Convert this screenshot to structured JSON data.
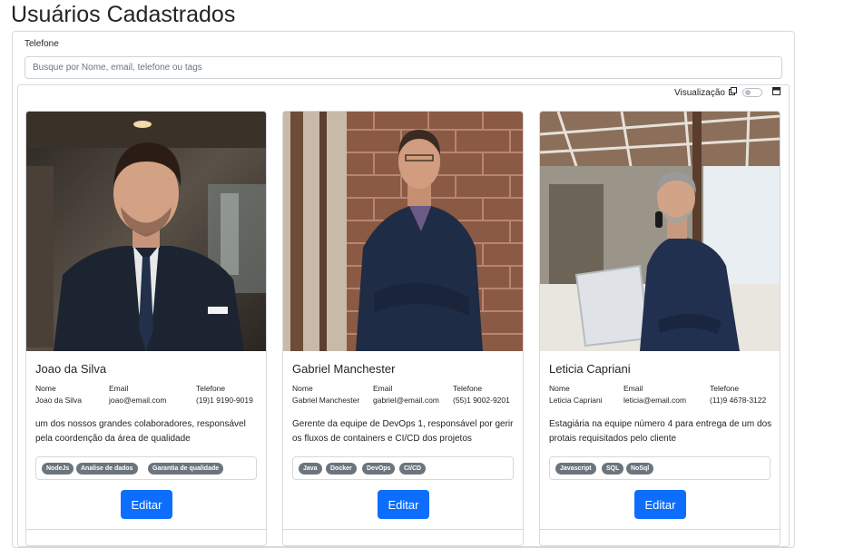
{
  "page": {
    "title": "Usuários Cadastrados"
  },
  "search": {
    "label": "Telefone",
    "placeholder": "Busque por Nome, email, telefone ou tags"
  },
  "view_toggle": {
    "label": "Visualização",
    "grid_icon": "grid-icon",
    "list_icon": "list-icon"
  },
  "column_labels": {
    "name": "Nome",
    "email": "Email",
    "phone": "Telefone"
  },
  "cards": [
    {
      "name": "Joao da Silva",
      "col_name": "Joao da Silva",
      "email": "joao@email.com",
      "phone": "(19)1 9190-9019",
      "description": "um dos nossos grandes colaboradores, responsável pela coordenção da área de qualidade",
      "tags": [
        "NodeJs",
        "Analise de dados",
        "Garantia de qualidade"
      ],
      "edit_label": "Editar"
    },
    {
      "name": "Gabriel Manchester",
      "col_name": "Gabriel Manchester",
      "email": "gabriel@email.com",
      "phone": "(55)1 9002-9201",
      "description": "Gerente da equipe de DevOps 1, responsável por gerir os fluxos de containers e CI/CD dos projetos",
      "tags": [
        "Java",
        "Docker",
        "DevOps",
        "CI/CD"
      ],
      "edit_label": "Editar"
    },
    {
      "name": "Leticia Capriani",
      "col_name": "Leticia Capriani",
      "email": "leticia@email.com",
      "phone": "(11)9 4678-3122",
      "description": "Estagiária na equipe número 4 para entrega de um dos protais requisitados pelo cliente",
      "tags": [
        "Javascript",
        "SQL",
        "NoSql"
      ],
      "edit_label": "Editar"
    }
  ],
  "colors": {
    "primary": "#0d6efd",
    "tag_bg": "#6c757d",
    "border": "#d6d9dc"
  }
}
